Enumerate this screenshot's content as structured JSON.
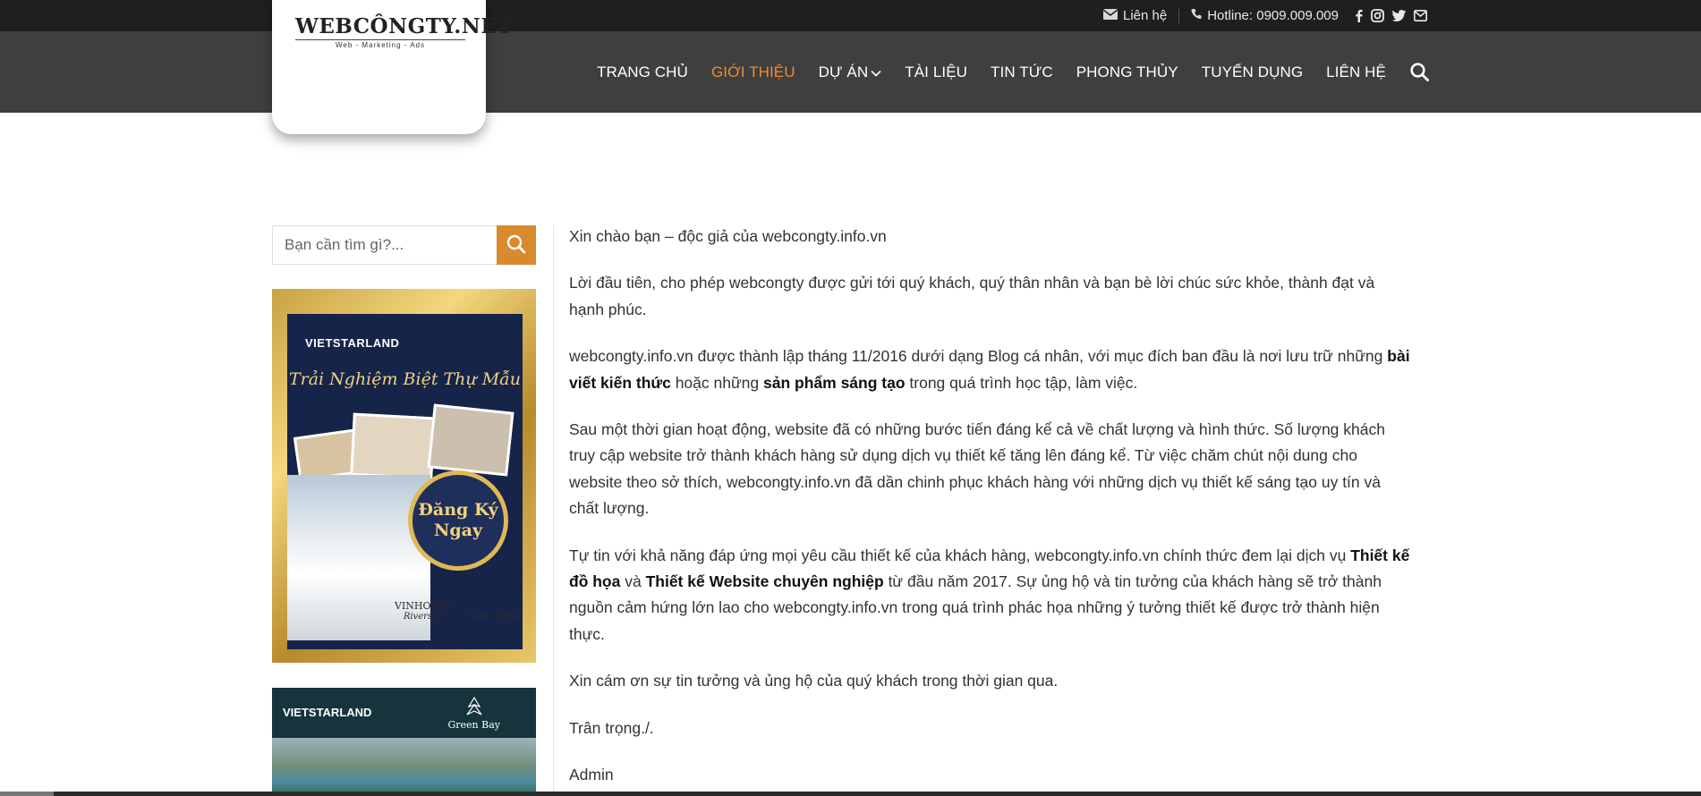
{
  "topbar": {
    "contact_label": "Liên hệ",
    "hotline_label": "Hotline: 0909.009.009",
    "social": [
      "facebook-icon",
      "instagram-icon",
      "twitter-icon",
      "email-icon"
    ]
  },
  "logo": {
    "text": "WEBCÔNGTY.NET",
    "tagline": "Web - Marketing - Ads"
  },
  "nav": {
    "items": [
      {
        "label": "TRANG CHỦ",
        "active": false
      },
      {
        "label": "GIỚI THIỆU",
        "active": true
      },
      {
        "label": "DỰ ÁN",
        "active": false,
        "dropdown": true
      },
      {
        "label": "TÀI LIỆU",
        "active": false
      },
      {
        "label": "TIN TỨC",
        "active": false
      },
      {
        "label": "PHONG THỦY",
        "active": false
      },
      {
        "label": "TUYỂN DỤNG",
        "active": false
      },
      {
        "label": "LIÊN HỆ",
        "active": false
      }
    ],
    "active_color": "#f08c2a"
  },
  "sidebar": {
    "search_placeholder": "Bạn cần tìm gì?...",
    "search_button_color": "#d88a2c",
    "banner1": {
      "brand": "VIETSTARLAND",
      "title": "Trải Nghiệm Biệt Thự Mẫu",
      "badge_line1": "Đăng Ký",
      "badge_line2": "Ngay",
      "footer_left": "VINHOMES",
      "footer_left_sub": "Riverside",
      "footer_right": "HARMONY"
    },
    "banner2": {
      "brand": "VIETSTARLAND",
      "logo": "Green Bay"
    }
  },
  "content": {
    "p1": "Xin chào bạn – độc giả của webcongty.info.vn",
    "p2": "Lời đầu tiên, cho phép webcongty được gửi tới quý khách, quý thân nhân và bạn bè lời chúc sức khỏe, thành đạt và hạnh phúc.",
    "p3_a": "webcongty.info.vn được thành lập tháng 11/2016 dưới dạng Blog cá nhân, với mục đích ban đầu là nơi lưu trữ những ",
    "p3_b": "bài viết kiến thức",
    "p3_c": " hoặc những ",
    "p3_d": "sản phẩm sáng tạo",
    "p3_e": " trong quá trình học tập, làm việc.",
    "p4": "Sau một thời gian hoạt động, website đã có những bước tiến đáng kể cả về chất lượng và hình thức. Số lượng khách truy cập website trở thành khách hàng sử dụng dịch vụ thiết kế tăng lên đáng kể. Từ việc chăm chút nội dung cho website theo sở thích, webcongty.info.vn đã dần chinh phục khách hàng với những dịch vụ thiết kế sáng tạo uy tín và chất lượng.",
    "p5_a": "Tự tin với khả năng đáp ứng mọi yêu cầu thiết kế của khách hàng, webcongty.info.vn chính thức đem lại dịch vụ ",
    "p5_b": "Thiết kế đồ họa",
    "p5_c": " và ",
    "p5_d": "Thiết kế Website chuyên nghiệp",
    "p5_e": " từ đầu năm 2017. Sự ủng hộ và tin tưởng của khách hàng sẽ trở thành nguồn cảm hứng lớn lao cho webcongty.info.vn trong quá trình phác họa những ý tưởng thiết kế được trở thành hiện thực.",
    "p6": "Xin cám ơn sự tin tưởng và ủng hộ của quý khách trong thời gian qua.",
    "p7": "Trân trọng./.",
    "p8": "Admin"
  }
}
